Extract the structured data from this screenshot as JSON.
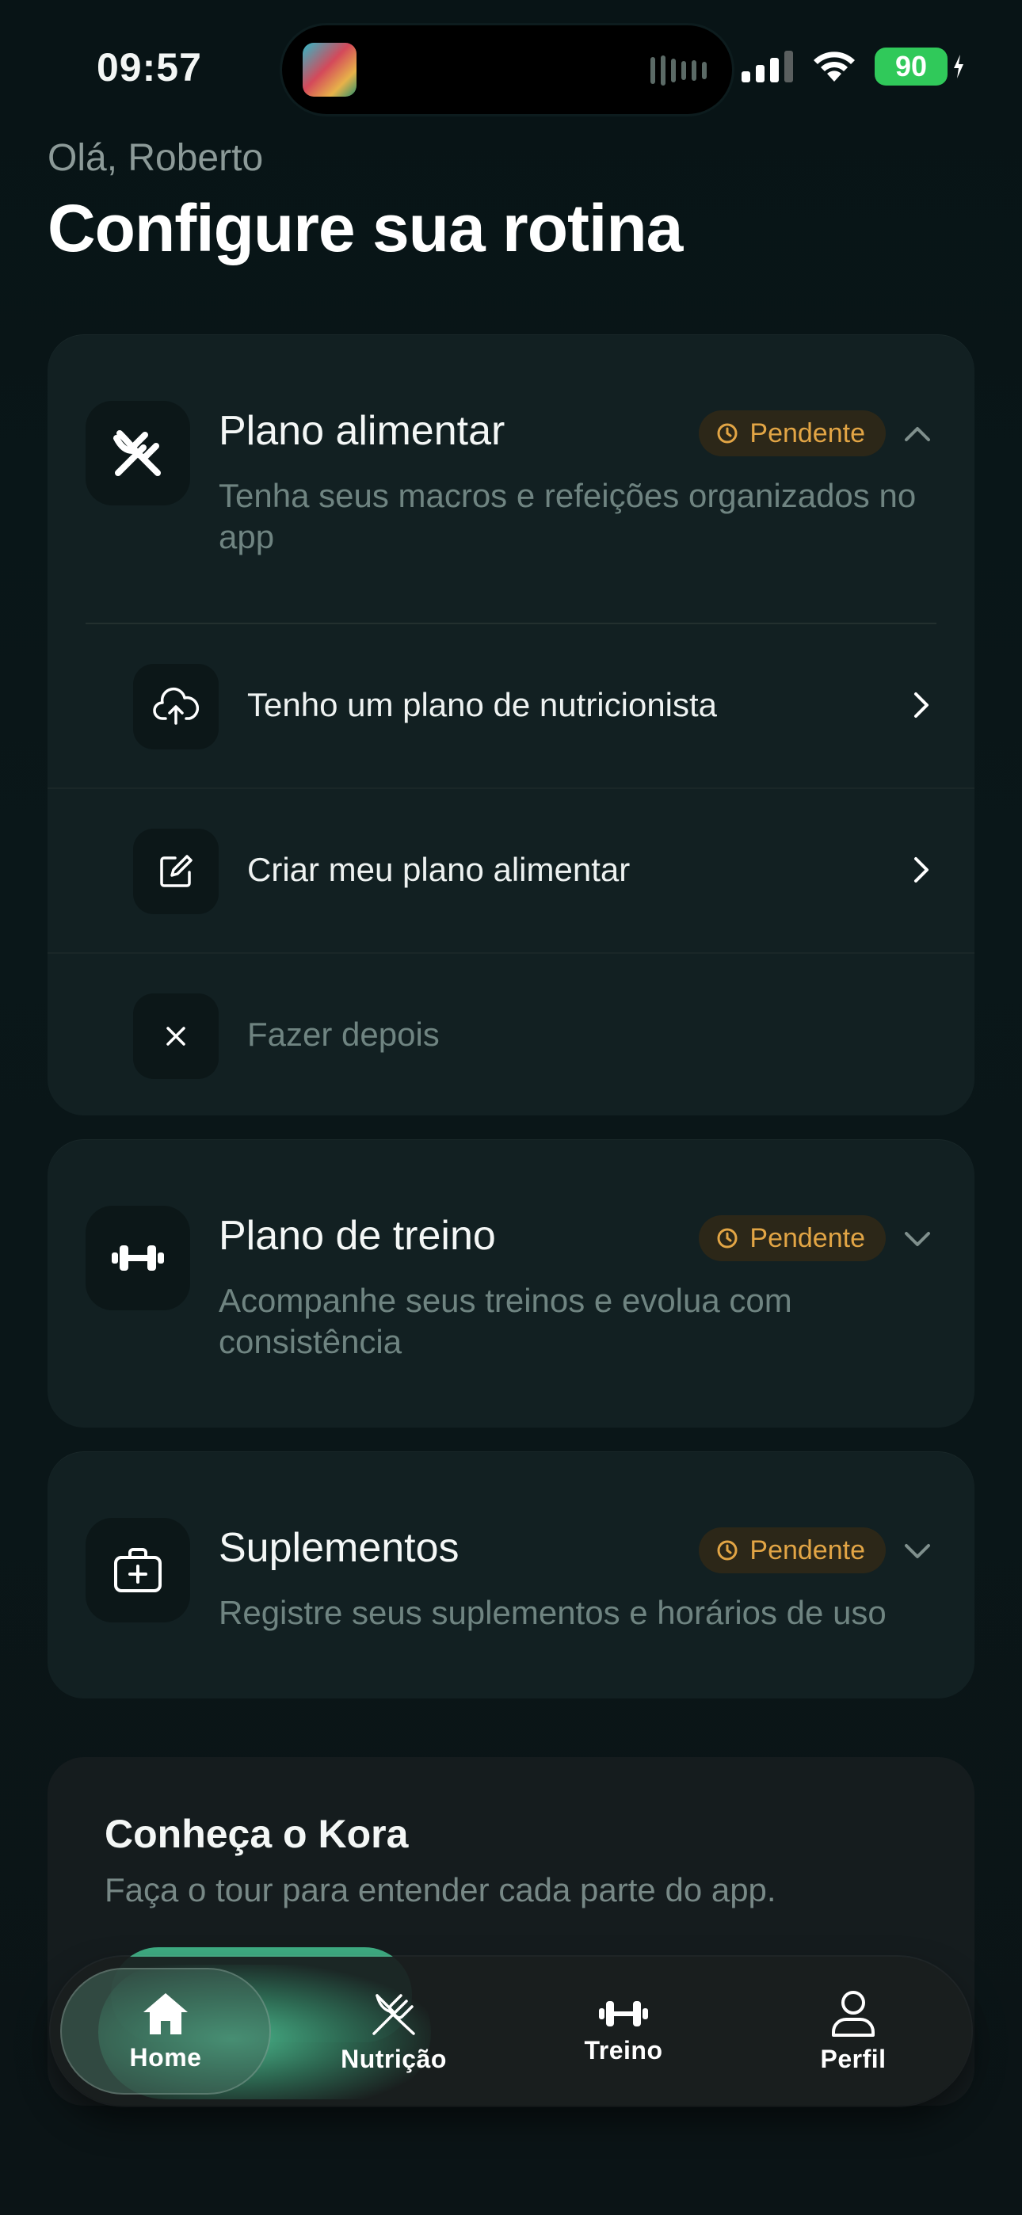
{
  "status_bar": {
    "time": "09:57",
    "battery": "90"
  },
  "header": {
    "greeting": "Olá, Roberto",
    "title": "Configure sua rotina"
  },
  "cards": [
    {
      "title": "Plano alimentar",
      "description": "Tenha seus macros e refeições organizados no app",
      "status": "Pendente",
      "expanded": true,
      "icon": "fork-knife-icon",
      "options": [
        {
          "label": "Tenho um plano de nutricionista",
          "icon": "cloud-upload-icon"
        },
        {
          "label": "Criar meu plano alimentar",
          "icon": "edit-icon"
        },
        {
          "label": "Fazer depois",
          "icon": "close-icon"
        }
      ]
    },
    {
      "title": "Plano de treino",
      "description": "Acompanhe seus treinos e evolua com consistência",
      "status": "Pendente",
      "expanded": false,
      "icon": "dumbbell-icon"
    },
    {
      "title": "Suplementos",
      "description": "Registre seus suplementos e horários de uso",
      "status": "Pendente",
      "expanded": false,
      "icon": "medkit-icon"
    }
  ],
  "kora": {
    "title": "Conheça o Kora",
    "subtitle": "Faça o tour para entender cada parte do app."
  },
  "tabbar": {
    "items": [
      {
        "label": "Home",
        "icon": "home-icon",
        "active": true
      },
      {
        "label": "Nutrição",
        "icon": "fork-knife-icon",
        "active": false
      },
      {
        "label": "Treino",
        "icon": "dumbbell-icon",
        "active": false
      },
      {
        "label": "Perfil",
        "icon": "person-icon",
        "active": false
      }
    ]
  },
  "colors": {
    "accent": "#3fae84",
    "pending": "#e2a545",
    "card": "#122022"
  }
}
